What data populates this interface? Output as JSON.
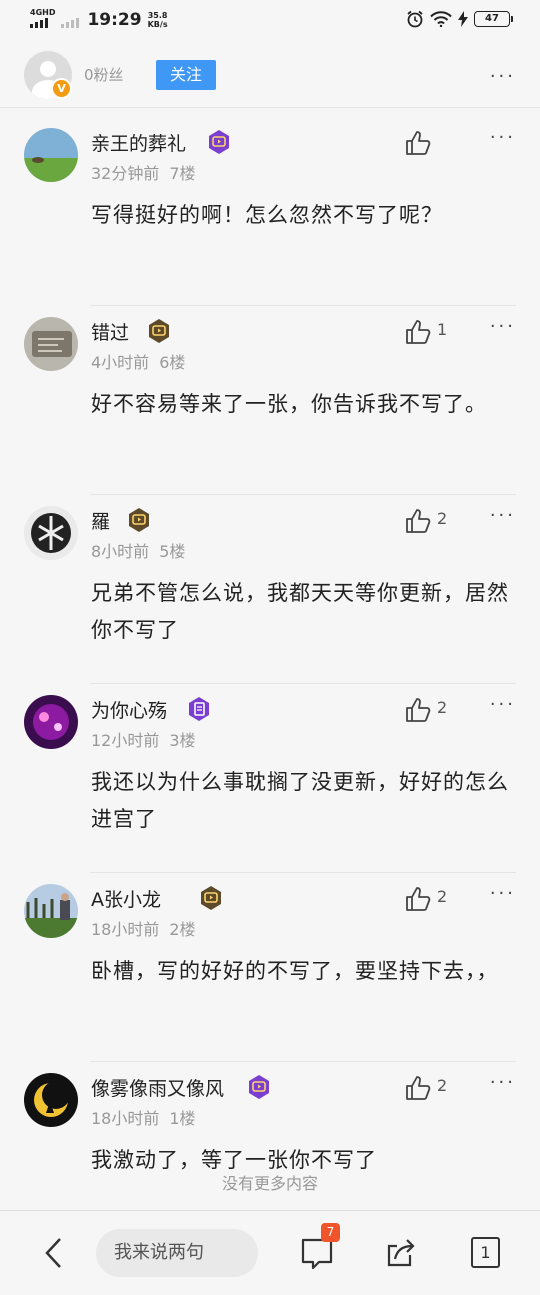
{
  "status_bar": {
    "network": "4GHD",
    "time": "19:29",
    "speed_value": "35.8",
    "speed_unit": "KB/s",
    "battery": "47"
  },
  "header": {
    "fans": "0粉丝",
    "follow_label": "关注",
    "more": "···",
    "badge": "V"
  },
  "comments": [
    {
      "name": "亲王的葬礼",
      "time": "32分钟前",
      "floor": "7楼",
      "likes": "",
      "text": "写得挺好的啊！怎么忽然不写了呢？",
      "badge_color": "#7a3fd0",
      "badge_icon": "play-icon"
    },
    {
      "name": "错过",
      "time": "4小时前",
      "floor": "6楼",
      "likes": "1",
      "text": "好不容易等来了一张，你告诉我不写了。",
      "badge_color": "#5c4a2a",
      "badge_icon": "play-icon"
    },
    {
      "name": "羅",
      "time": "8小时前",
      "floor": "5楼",
      "likes": "2",
      "text": "兄弟不管怎么说，我都天天等你更新，居然你不写了",
      "badge_color": "#5c4a2a",
      "badge_icon": "play-icon"
    },
    {
      "name": "为你心殇",
      "time": "12小时前",
      "floor": "3楼",
      "likes": "2",
      "text": "我还以为什么事耽搁了没更新，好好的怎么进宫了",
      "badge_color": "#7a3fd0",
      "badge_icon": "book-icon"
    },
    {
      "name": "A⁠张小龙",
      "time": "18小时前",
      "floor": "2楼",
      "likes": "2",
      "text": "卧槽，写的好好的不写了，要坚持下去，，",
      "badge_color": "#5c4a2a",
      "badge_icon": "play-icon"
    },
    {
      "name": "像雾像雨又像风",
      "time": "18小时前",
      "floor": "1楼",
      "likes": "2",
      "text": "我激动了，等了一张你不写了",
      "badge_color": "#7a3fd0",
      "badge_icon": "play-icon"
    }
  ],
  "no_more": "没有更多内容",
  "bottom_bar": {
    "input_placeholder": "我来说两句",
    "message_badge": "7",
    "tab_count": "1"
  }
}
